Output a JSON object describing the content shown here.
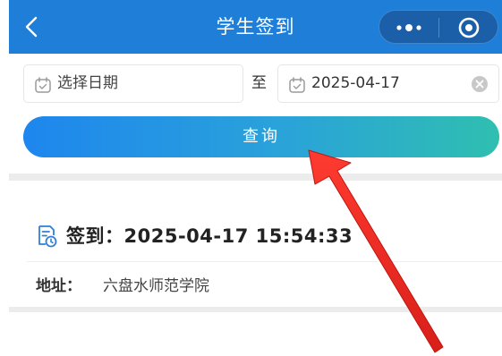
{
  "navbar": {
    "title": "学生签到",
    "back_icon": "chevron-left-icon",
    "more_icon": "more-dots-icon",
    "close_icon": "target-close-icon",
    "color": "#1f7fd8"
  },
  "date_range": {
    "start_placeholder": "选择日期",
    "to_label": "至",
    "end_value": "2025-04-17"
  },
  "query_button": {
    "label": "查询"
  },
  "record": {
    "icon": "checkin-record-icon",
    "title": "签到：2025-04-17 15:54:33",
    "address_label": "地址：",
    "address_value": "六盘水师范学院"
  },
  "annotation": {
    "arrow_color": "#ee2b24"
  }
}
